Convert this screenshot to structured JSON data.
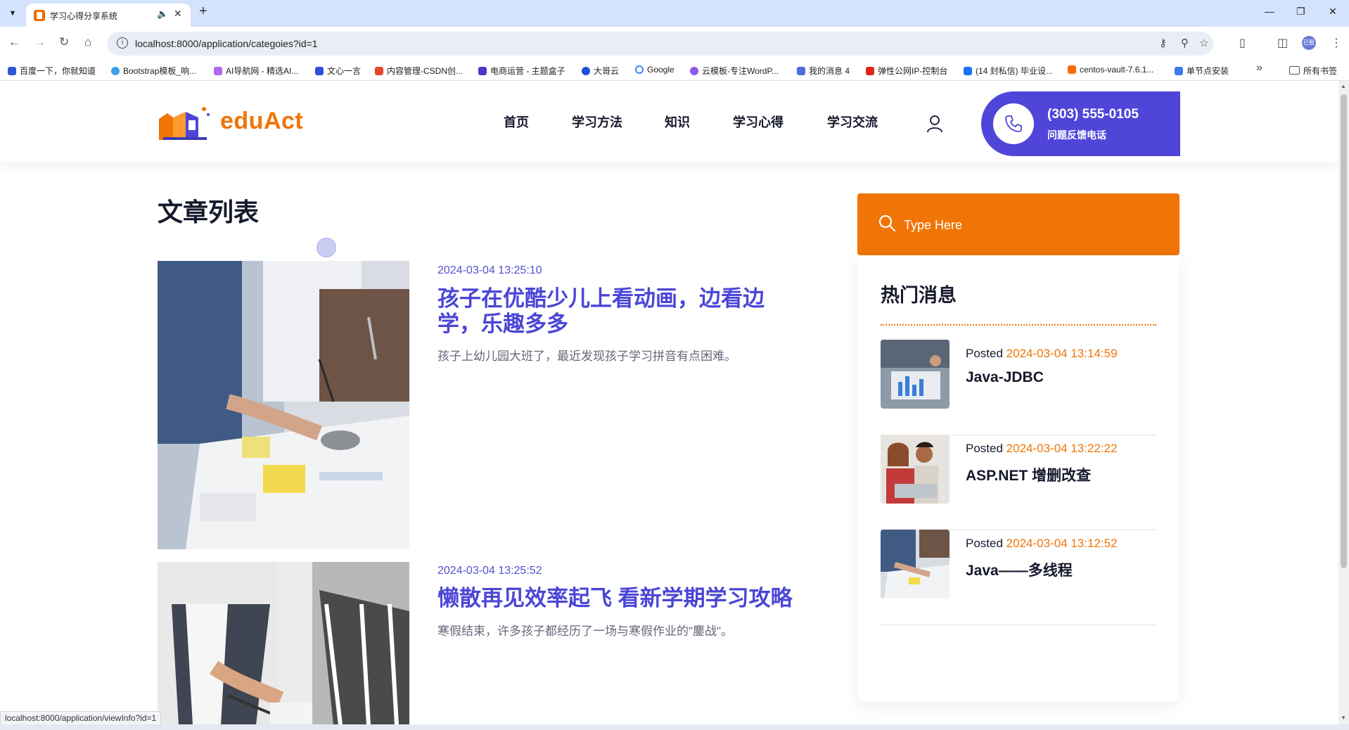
{
  "browser": {
    "tab_title": "学习心得分享系统",
    "url": "localhost:8000/application/categoies?id=1",
    "bookmarks": [
      "百度一下，你就知道",
      "Bootstrap模板_响...",
      "AI导航网 - 精选AI...",
      "文心一言",
      "内容管理-CSDN创...",
      "电商运营 - 主题盒子",
      "大哥云",
      "Google",
      "云模板-专注WordP...",
      "我的消息 4",
      "弹性公网IP-控制台",
      "(14 封私信) 毕业设...",
      "centos-vault-7.6.1...",
      "单节点安装"
    ],
    "bookmarks_all": "所有书签",
    "status_url": "localhost:8000/application/viewInfo?id=1",
    "profile_badge": "已暂"
  },
  "header": {
    "logo_text": "eduAct",
    "nav": [
      "首页",
      "学习方法",
      "知识",
      "学习心得",
      "学习交流"
    ],
    "phone_number": "(303) 555-0105",
    "phone_label": "问题反馈电话"
  },
  "main": {
    "section_title": "文章列表",
    "articles": [
      {
        "date": "2024-03-04 13:25:10",
        "title": "孩子在优酷少儿上看动画，边看边学，乐趣多多",
        "excerpt": "孩子上幼儿园大班了，最近发现孩子学习拼音有点困难。"
      },
      {
        "date": "2024-03-04 13:25:52",
        "title": "懒散再见效率起飞 看新学期学习攻略",
        "excerpt": "寒假结束，许多孩子都经历了一场与寒假作业的\"鏖战\"。"
      }
    ]
  },
  "sidebar": {
    "search_placeholder": "Type Here",
    "widget_title": "热门消息",
    "posted_label": "Posted",
    "posts": [
      {
        "date": "2024-03-04 13:14:59",
        "title": "Java-JDBC"
      },
      {
        "date": "2024-03-04 13:22:22",
        "title": "ASP.NET 增删改查"
      },
      {
        "date": "2024-03-04 13:12:52",
        "title": "Java——多线程"
      }
    ]
  },
  "colors": {
    "accent_orange": "#f07406",
    "accent_blue": "#4f46d9",
    "heading_dark": "#16192c"
  }
}
